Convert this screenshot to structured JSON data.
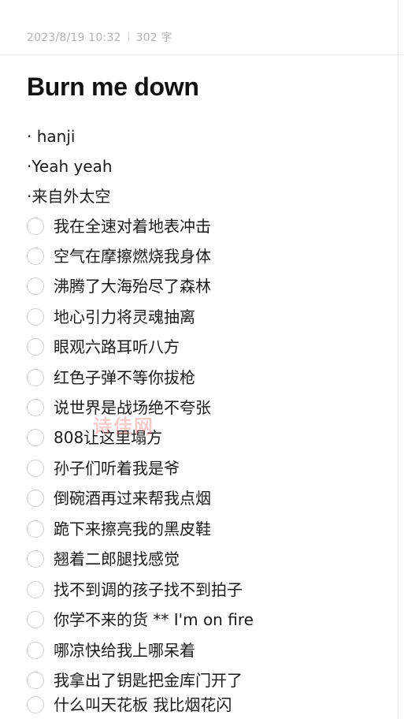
{
  "meta": {
    "datetime": "2023/8/19 10:32",
    "word_count": "302 字"
  },
  "note": {
    "title": "Burn me down",
    "lines": [
      "· hanji",
      "·Yeah yeah",
      "·来自外太空"
    ],
    "checklist": [
      "我在全速对着地表冲击",
      "空气在摩擦燃烧我身体",
      "沸腾了大海殆尽了森林",
      "地心引力将灵魂抽离",
      "眼观六路耳听八方",
      "红色子弹不等你拔枪",
      "说世界是战场绝不夸张",
      "808让这里塌方",
      "孙子们听着我是爷",
      "倒碗酒再过来帮我点烟",
      "跪下来擦亮我的黑皮鞋",
      "翘着二郎腿找感觉",
      "找不到调的孩子找不到拍子",
      "你学不来的货 ** I'm on fire",
      "哪凉快给我上哪呆着",
      "我拿出了钥匙把金库门开了",
      "什么叫天花板 我比烟花闪"
    ]
  },
  "watermark": "诗佳网"
}
